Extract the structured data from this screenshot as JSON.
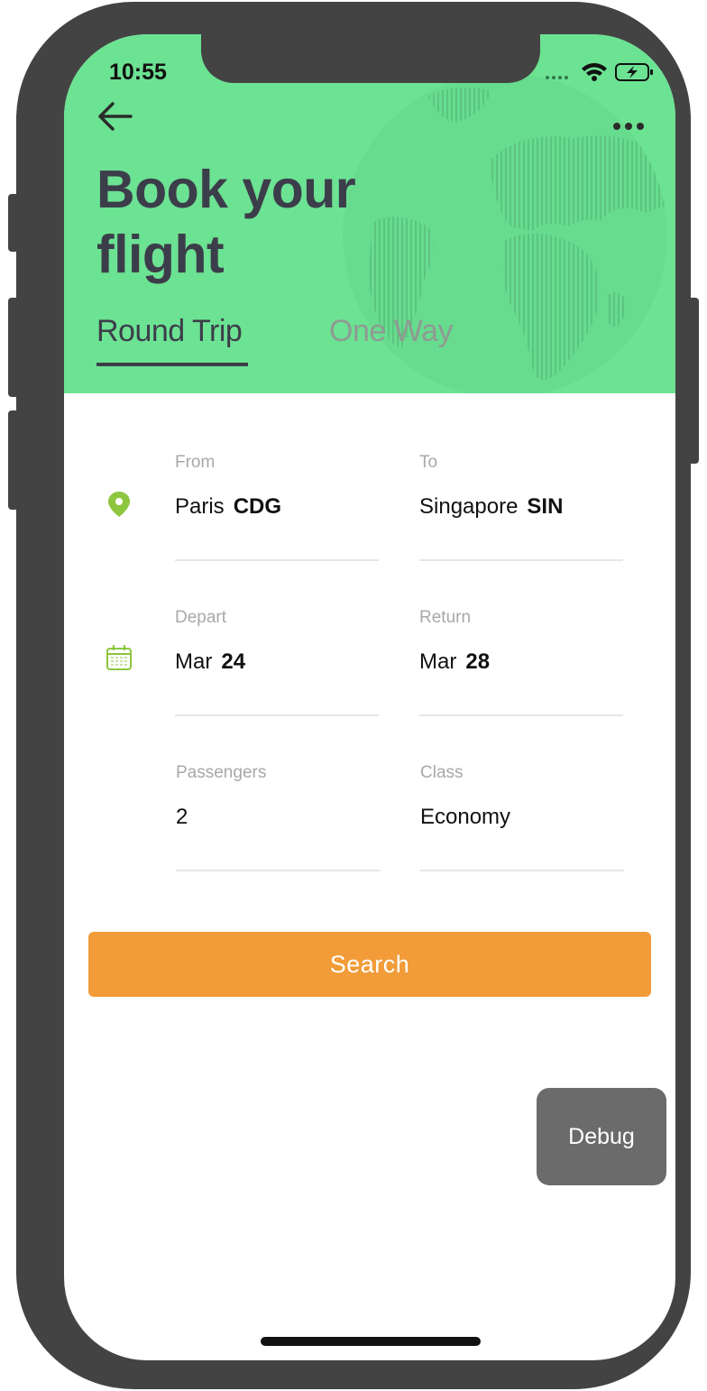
{
  "status_bar": {
    "time": "10:55"
  },
  "header": {
    "title_line1": "Book your",
    "title_line2": "flight",
    "background_color": "#6ce293",
    "icons": [
      "back-arrow-icon",
      "more-dots-icon",
      "globe-icon"
    ]
  },
  "tabs": [
    {
      "label": "Round Trip",
      "active": true
    },
    {
      "label": "One Way",
      "active": false
    }
  ],
  "form": {
    "from": {
      "label": "From",
      "city": "Paris",
      "code": "CDG"
    },
    "to": {
      "label": "To",
      "city": "Singapore",
      "code": "SIN"
    },
    "depart": {
      "label": "Depart",
      "month": "Mar",
      "day": "24"
    },
    "return": {
      "label": "Return",
      "month": "Mar",
      "day": "28"
    },
    "passengers": {
      "label": "Passengers",
      "value": "2"
    },
    "class": {
      "label": "Class",
      "value": "Economy"
    },
    "icons": [
      "location-pin-icon",
      "calendar-icon"
    ],
    "accent_color": "#8dc63f"
  },
  "search_button": {
    "label": "Search",
    "color": "#f19c38"
  },
  "debug_button": {
    "label": "Debug"
  }
}
